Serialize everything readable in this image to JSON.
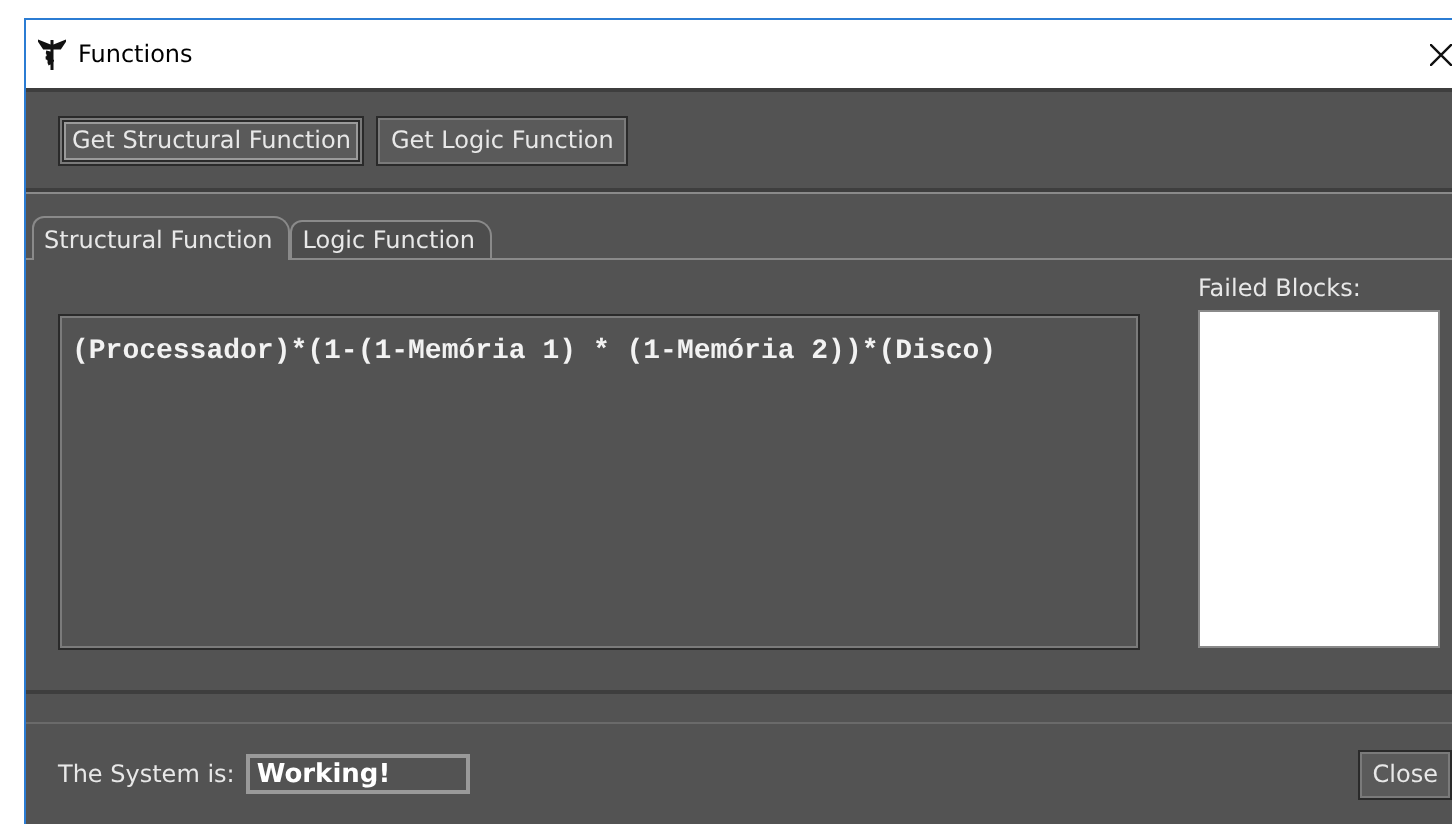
{
  "window": {
    "title": "Functions"
  },
  "toolbar": {
    "buttons": [
      {
        "label": "Get Structural Function",
        "focused": true
      },
      {
        "label": "Get Logic Function",
        "focused": false
      }
    ]
  },
  "tabs": [
    {
      "label": "Structural Function",
      "selected": true
    },
    {
      "label": "Logic Function",
      "selected": false
    }
  ],
  "function_text": "(Processador)*(1-(1-Memória 1) * (1-Memória 2))*(Disco)",
  "failed_blocks": {
    "label": "Failed Blocks:"
  },
  "status": {
    "label": "The System is:",
    "value": "Working!"
  },
  "close_button": "Close"
}
